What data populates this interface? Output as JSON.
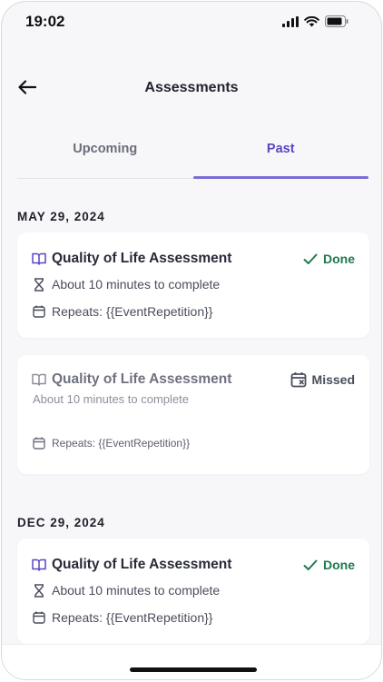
{
  "status_bar": {
    "time": "19:02"
  },
  "header": {
    "title": "Assessments"
  },
  "tabs": [
    {
      "label": "Upcoming",
      "active": false
    },
    {
      "label": "Past",
      "active": true
    }
  ],
  "sections": [
    {
      "date": "MAY 29, 2024",
      "cards": [
        {
          "title": "Quality of Life Assessment",
          "duration": "About 10 minutes to complete",
          "repeats": "Repeats: {{EventRepetition}}",
          "status": "Done"
        },
        {
          "title": "Quality of Life Assessment",
          "duration": "About 10 minutes to complete",
          "repeats": "Repeats: {{EventRepetition}}",
          "status": "Missed"
        }
      ]
    },
    {
      "date": "DEC 29, 2024",
      "cards": [
        {
          "title": "Quality of Life Assessment",
          "duration": "About 10 minutes to complete",
          "repeats": "Repeats: {{EventRepetition}}",
          "status": "Done"
        }
      ]
    }
  ],
  "colors": {
    "accent": "#5b46c4",
    "done": "#1f7a4d",
    "background": "#f7f7fa"
  },
  "icons": [
    "back-arrow-icon",
    "book-icon",
    "hourglass-icon",
    "calendar-icon",
    "check-icon",
    "calendar-missed-icon",
    "signal-icon",
    "wifi-icon",
    "battery-icon"
  ]
}
